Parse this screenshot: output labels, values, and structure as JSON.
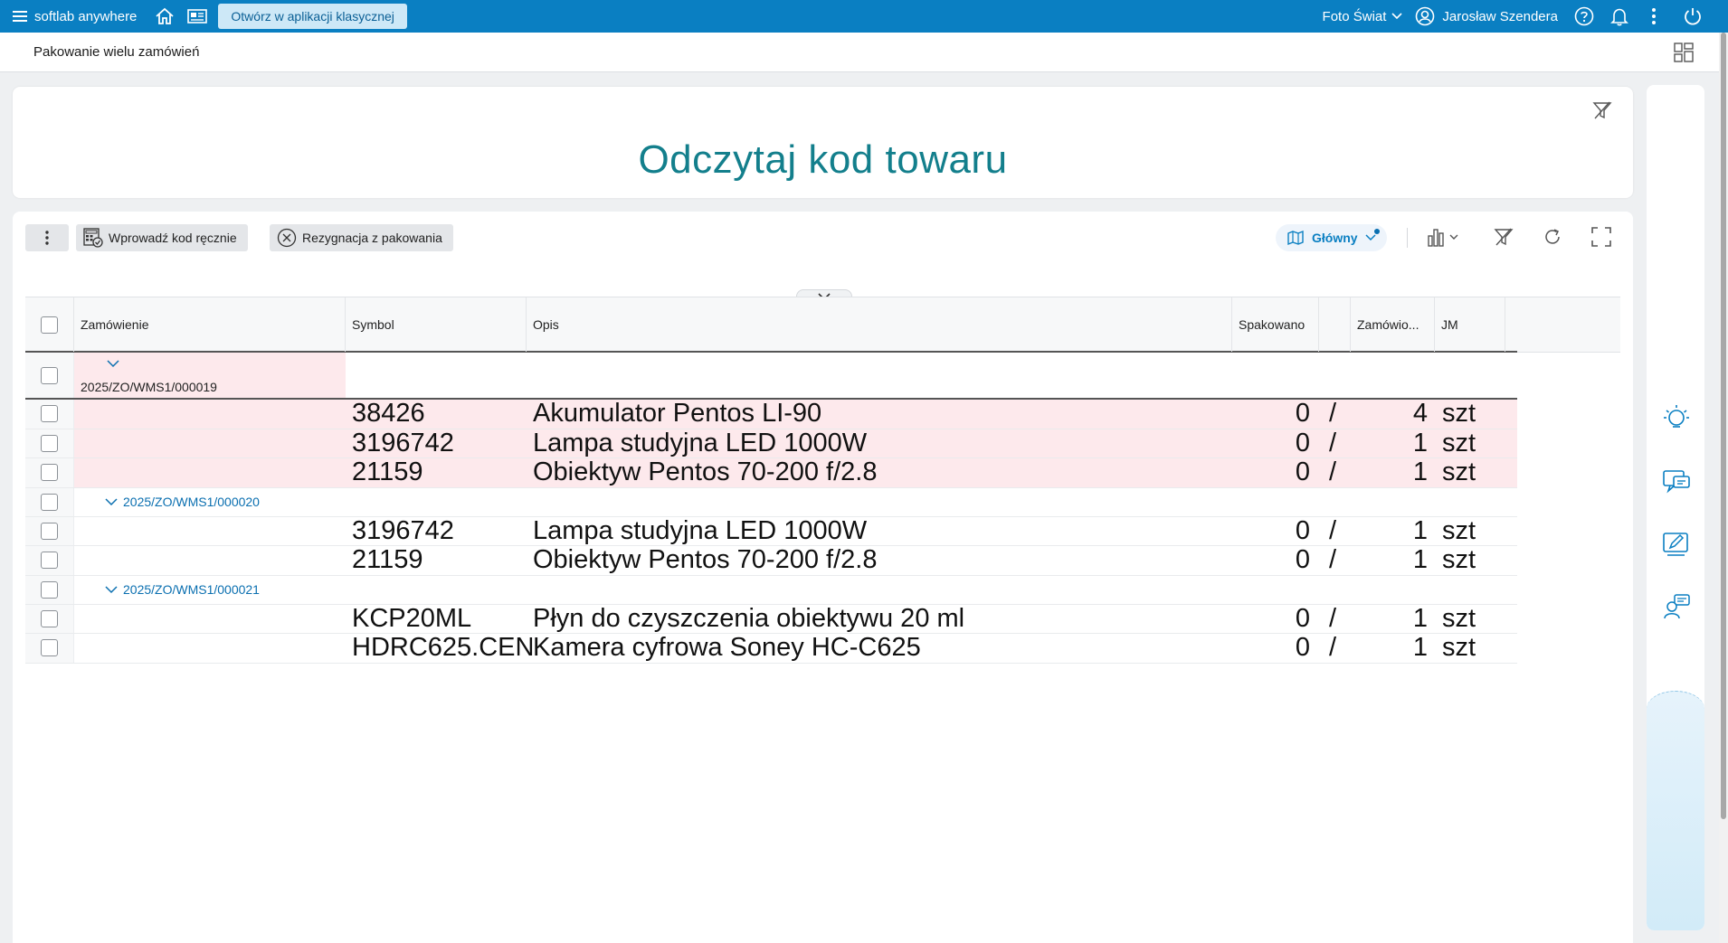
{
  "topbar": {
    "brand": "softlab anywhere",
    "open_classic": "Otwórz w aplikacji klasycznej",
    "company": "Foto Świat",
    "user": "Jarosław Szendera"
  },
  "titlebar": {
    "title": "Pakowanie wielu zamówień"
  },
  "scan": {
    "prompt": "Odczytaj kod towaru"
  },
  "toolbar": {
    "enter_code": "Wprowadź kod ręcznie",
    "cancel_packing": "Rezygnacja z pakowania",
    "view": "Główny"
  },
  "grid": {
    "columns": {
      "order": "Zamówienie",
      "symbol": "Symbol",
      "description": "Opis",
      "packed": "Spakowano",
      "ordered": "Zamówio...",
      "unit": "JM"
    },
    "groups": [
      {
        "order": "2025/ZO/WMS1/000019",
        "rows": [
          {
            "symbol": "38426",
            "description": "Akumulator Pentos LI-90",
            "packed": "0",
            "sep": "/",
            "ordered": "4",
            "unit": "szt"
          },
          {
            "symbol": "3196742",
            "description": "Lampa studyjna LED 1000W",
            "packed": "0",
            "sep": "/",
            "ordered": "1",
            "unit": "szt"
          },
          {
            "symbol": "21159",
            "description": "Obiektyw Pentos 70-200 f/2.8",
            "packed": "0",
            "sep": "/",
            "ordered": "1",
            "unit": "szt"
          }
        ]
      },
      {
        "order": "2025/ZO/WMS1/000020",
        "rows": [
          {
            "symbol": "3196742",
            "description": "Lampa studyjna LED 1000W",
            "packed": "0",
            "sep": "/",
            "ordered": "1",
            "unit": "szt"
          },
          {
            "symbol": "21159",
            "description": "Obiektyw Pentos 70-200 f/2.8",
            "packed": "0",
            "sep": "/",
            "ordered": "1",
            "unit": "szt"
          }
        ]
      },
      {
        "order": "2025/ZO/WMS1/000021",
        "rows": [
          {
            "symbol": "KCP20ML",
            "description": "Płyn do czyszczenia obiektywu 20 ml",
            "packed": "0",
            "sep": "/",
            "ordered": "1",
            "unit": "szt"
          },
          {
            "symbol": "HDRC625.CEN",
            "description": "Kamera cyfrowa Soney HC-C625",
            "packed": "0",
            "sep": "/",
            "ordered": "1",
            "unit": "szt"
          }
        ]
      }
    ]
  }
}
